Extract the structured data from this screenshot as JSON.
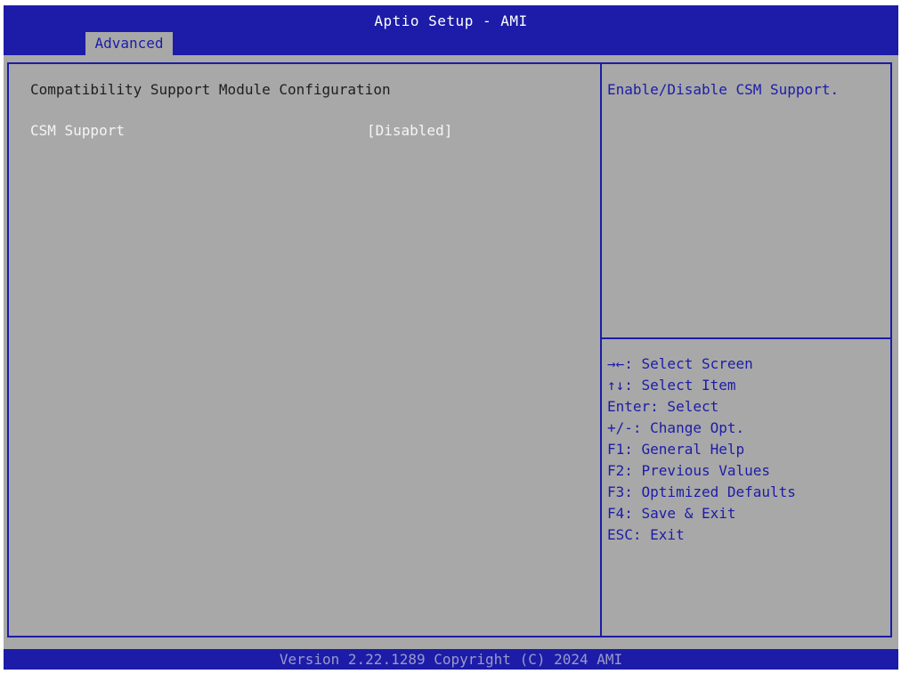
{
  "header": {
    "title": "Aptio Setup - AMI",
    "tabs": [
      {
        "label": "Advanced",
        "active": true
      }
    ]
  },
  "main": {
    "section_title": "Compatibility Support Module Configuration",
    "settings": [
      {
        "label": "CSM Support",
        "value": "[Disabled]"
      }
    ]
  },
  "help": {
    "text": "Enable/Disable CSM Support.",
    "keys": [
      "→←: Select Screen",
      "↑↓: Select Item",
      "Enter: Select",
      "+/-: Change Opt.",
      "F1: General Help",
      "F2: Previous Values",
      "F3: Optimized Defaults",
      "F4: Save & Exit",
      "ESC: Exit"
    ]
  },
  "footer": {
    "version": "Version 2.22.1289 Copyright (C) 2024 AMI"
  },
  "colors": {
    "header_blue": "#1c1ca8",
    "panel_gray": "#a8a8a8",
    "highlight_text": "#f5f5f5"
  }
}
